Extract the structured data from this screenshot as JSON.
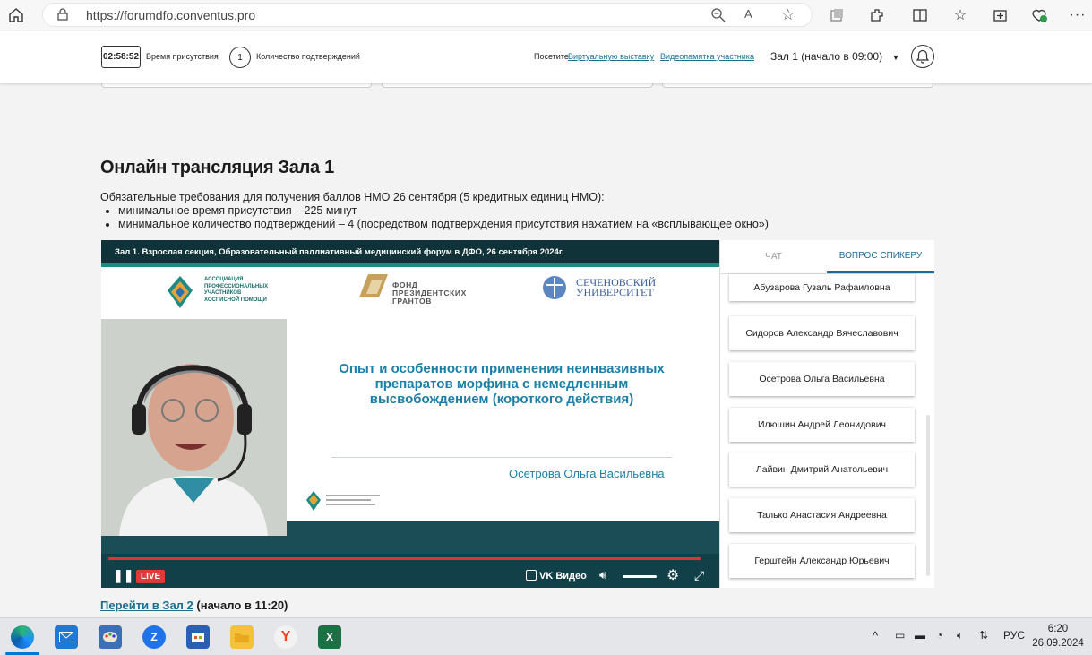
{
  "browser": {
    "url": "https://forumdfo.conventus.pro"
  },
  "topbar": {
    "timer": "02:58:52",
    "timer_label": "Время присутствия",
    "confirm_count": "1",
    "confirm_label": "Количество подтверждений",
    "visit_prefix": "Посетите",
    "visit_link": "Виртуальную выставку",
    "video_link": "Видеопамятка участника",
    "hall_select": "Зал 1 (начало в  09:00)"
  },
  "main": {
    "title": "Онлайн трансляция Зала 1",
    "req_intro": "Обязательные требования для получения баллов НМО 26 сентября (5 кредитных единиц НМО):",
    "req_items": [
      "минимальное время присутствия – 225 минут",
      "минимальное количество подтверждений – 4 (посредством подтверждения присутствия нажатием на «всплывающее окно»)"
    ]
  },
  "player": {
    "title": "Зал 1. Взрослая секция, Образовательный паллиативный медицинский форум в ДФО, 26 сентября 2024г.",
    "logo1": "АССОЦИАЦИЯ ПРОФЕССИОНАЛЬНЫХ УЧАСТНИКОВ ХОСПИСНОЙ ПОМОЩИ",
    "logo2": "ФОНД ПРЕЗИДЕНТСКИХ ГРАНТОВ",
    "logo3": "СЕЧЕНОВСКИЙ УНИВЕРСИТЕТ",
    "slide_title": "Опыт и особенности применения неинвазивных препаратов морфина с немедленным высвобождением (короткого действия)",
    "slide_author": "Осетрова Ольга Васильевна",
    "live": "LIVE",
    "vk": "VK Видео",
    "progress": 0.98
  },
  "side": {
    "tabs": [
      "ЧАТ",
      "ВОПРОС СПИКЕРУ"
    ],
    "speakers": [
      "Абузарова Гузаль Рафаиловна",
      "Сидоров Александр Вячеславович",
      "Осетрова Ольга Васильевна",
      "Илюшин Андрей Леонидович",
      "Лайвин Дмитрий Анатольевич",
      "Талько Анастасия Андреевна",
      "Герштейн Александр Юрьевич"
    ]
  },
  "footer": {
    "hall2_link": "Перейти в Зал 2",
    "hall2_note": " (начало в 11:20)"
  },
  "taskbar": {
    "lang": "РУС",
    "time": "6:20",
    "date": "26.09.2024",
    "accent": "#0078d4"
  }
}
